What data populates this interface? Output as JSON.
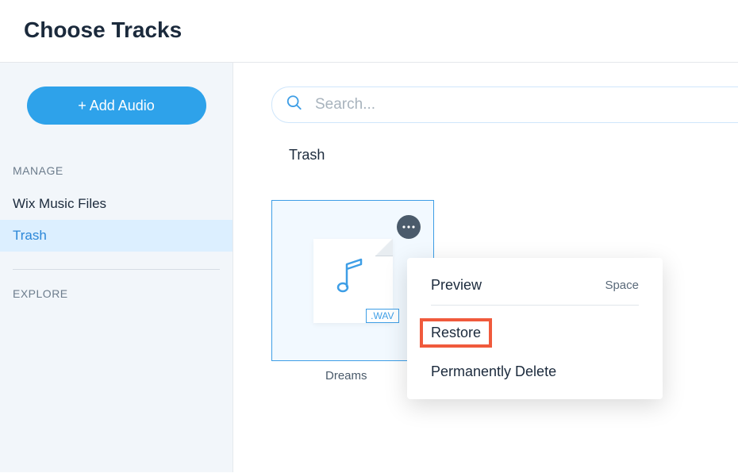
{
  "header": {
    "title": "Choose Tracks"
  },
  "sidebar": {
    "add_button": "+ Add Audio",
    "manage_label": "MANAGE",
    "explore_label": "EXPLORE",
    "items": [
      {
        "label": "Wix Music Files"
      },
      {
        "label": "Trash"
      }
    ]
  },
  "search": {
    "placeholder": "Search..."
  },
  "breadcrumb": "Trash",
  "track": {
    "name": "Dreams",
    "ext": ".WAV"
  },
  "menu": {
    "preview": "Preview",
    "preview_shortcut": "Space",
    "restore": "Restore",
    "delete": "Permanently Delete"
  }
}
